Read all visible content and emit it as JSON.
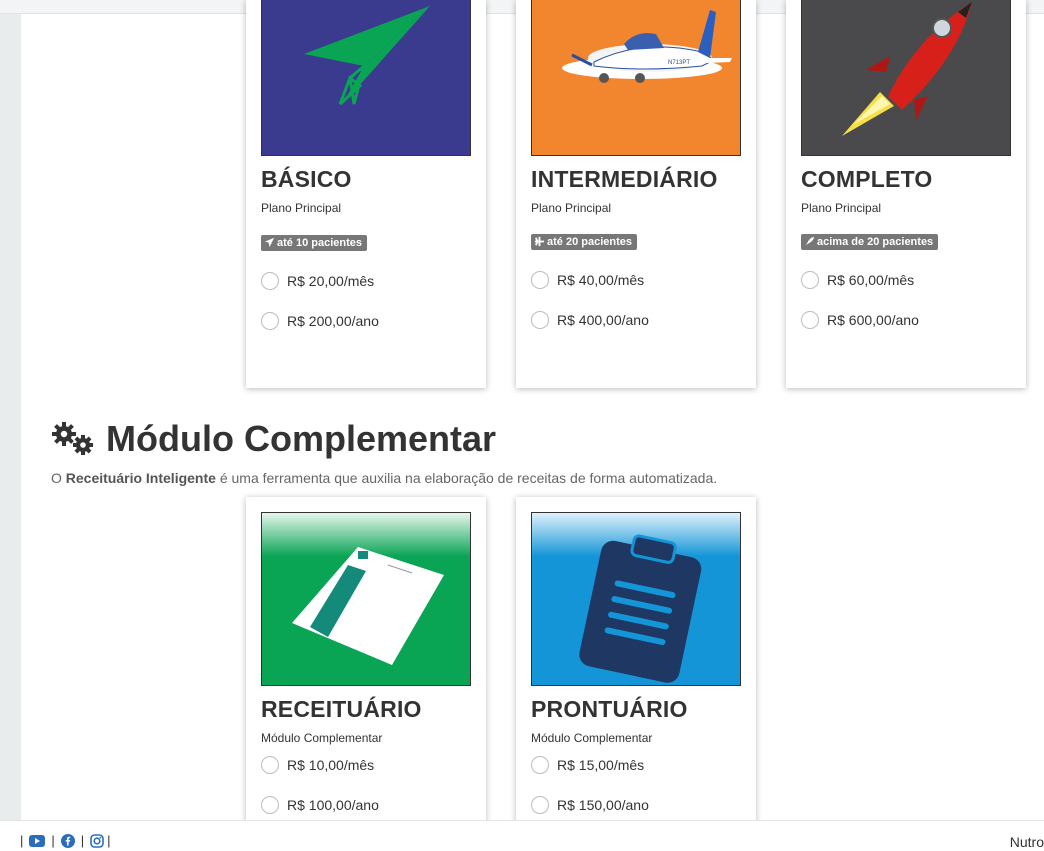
{
  "plans": [
    {
      "title": "BÁSICO",
      "subtitle": "Plano Principal",
      "badge": "até 10 pacientes",
      "badge_icon": "paper-plane-icon",
      "image": "paper-plane",
      "image_bg": "#3a3a8f",
      "options": [
        "R$ 20,00/mês",
        "R$ 200,00/ano"
      ]
    },
    {
      "title": "INTERMEDIÁRIO",
      "subtitle": "Plano Principal",
      "badge": "até 20 pacientes",
      "badge_icon": "plane-icon",
      "image": "airplane",
      "image_bg": "#f1862f",
      "options": [
        "R$ 40,00/mês",
        "R$ 400,00/ano"
      ]
    },
    {
      "title": "COMPLETO",
      "subtitle": "Plano Principal",
      "badge": "acima de 20 pacientes",
      "badge_icon": "rocket-icon",
      "image": "rocket",
      "image_bg": "#4a4a4c",
      "options": [
        "R$ 60,00/mês",
        "R$ 600,00/ano"
      ]
    }
  ],
  "complement_section": {
    "title": "Módulo Complementar",
    "icon": "gears-icon",
    "desc_prefix": "O ",
    "desc_bold": "Receituário Inteligente",
    "desc_suffix": " é uma ferramenta que auxilia na elaboração de receitas de forma automatizada."
  },
  "modules": [
    {
      "title": "RECEITUÁRIO",
      "subtitle": "Módulo Complementar",
      "image": "prescription-paper",
      "image_bg": "#0aa455",
      "options": [
        "R$ 10,00/mês",
        "R$ 100,00/ano"
      ]
    },
    {
      "title": "PRONTUÁRIO",
      "subtitle": "Módulo Complementar",
      "image": "clipboard",
      "image_bg": "#1495d7",
      "options": [
        "R$ 15,00/mês",
        "R$ 150,00/ano"
      ]
    }
  ],
  "footer": {
    "separator": "|",
    "icons": [
      "youtube-icon",
      "facebook-icon",
      "instagram-icon"
    ],
    "brand": "Nutro"
  },
  "colors": {
    "badge_bg": "#777777",
    "text": "#333333",
    "youtube_blue": "#2a6ebb"
  }
}
